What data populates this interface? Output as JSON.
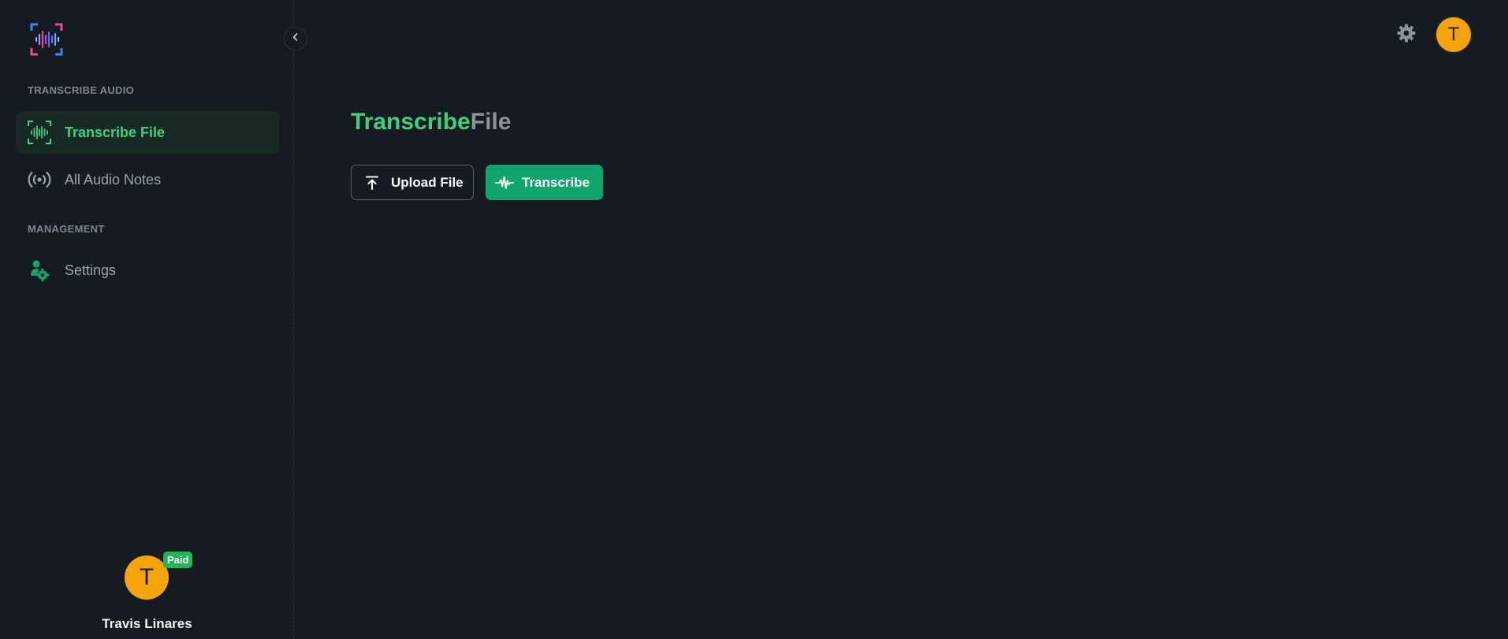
{
  "sidebar": {
    "sections": [
      {
        "label": "TRANSCRIBE AUDIO",
        "items": [
          {
            "label": "Transcribe File",
            "icon": "waveform-icon",
            "active": true
          },
          {
            "label": "All Audio Notes",
            "icon": "broadcast-icon",
            "active": false
          }
        ]
      },
      {
        "label": "MANAGEMENT",
        "items": [
          {
            "label": "Settings",
            "icon": "settings-cogs-icon",
            "active": false
          }
        ]
      }
    ],
    "user": {
      "avatar_letter": "T",
      "badge": "Paid",
      "name": "Travis Linares"
    }
  },
  "header": {
    "avatar_letter": "T"
  },
  "main": {
    "title_primary": "Transcribe",
    "title_secondary": "File",
    "upload_label": "Upload File",
    "transcribe_label": "Transcribe"
  },
  "colors": {
    "background": "#161b22",
    "accent_green": "#3fcf7f",
    "button_green": "#0fa56c",
    "avatar_orange": "#f5a50a",
    "badge_green": "#22b45a"
  }
}
